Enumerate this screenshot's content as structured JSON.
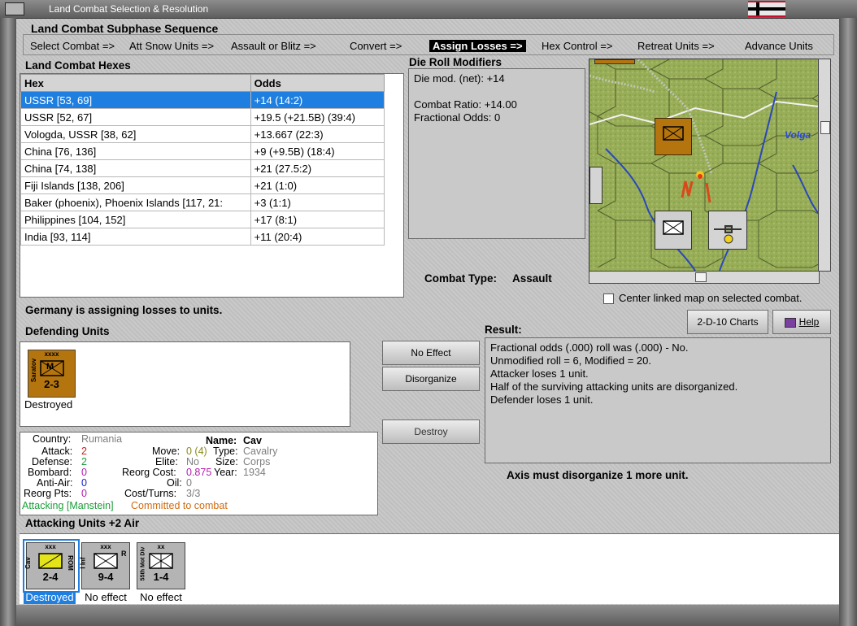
{
  "window": {
    "title": "Land Combat Selection & Resolution"
  },
  "sequence": {
    "label": "Land Combat Subphase Sequence",
    "steps": [
      {
        "label": "Select Combat =>"
      },
      {
        "label": "Att Snow Units =>"
      },
      {
        "label": "Assault or Blitz =>"
      },
      {
        "label": "Convert =>"
      },
      {
        "label": "Assign Losses =>",
        "active": true
      },
      {
        "label": "Hex Control =>"
      },
      {
        "label": "Retreat Units =>"
      },
      {
        "label": "Advance Units"
      }
    ]
  },
  "hexes": {
    "title": "Land Combat Hexes",
    "columns": [
      "Hex",
      "Odds"
    ],
    "rows": [
      {
        "hex": "USSR [53, 69]",
        "odds": "+14 (14:2)"
      },
      {
        "hex": "USSR [52, 67]",
        "odds": "+19.5 (+21.5B) (39:4)"
      },
      {
        "hex": "Vologda, USSR [38, 62]",
        "odds": "+13.667 (22:3)"
      },
      {
        "hex": "China [76, 136]",
        "odds": "+9 (+9.5B) (18:4)"
      },
      {
        "hex": "China [74, 138]",
        "odds": "+21 (27.5:2)"
      },
      {
        "hex": "Fiji Islands [138, 206]",
        "odds": "+21 (1:0)"
      },
      {
        "hex": "Baker (phoenix), Phoenix Islands [117, 21:",
        "odds": "+3 (1:1)"
      },
      {
        "hex": "Philippines [104, 152]",
        "odds": "+17 (8:1)"
      },
      {
        "hex": "India [93, 114]",
        "odds": "+11 (20:4)"
      }
    ]
  },
  "modifiers": {
    "title": "Die Roll Modifiers",
    "die_mod": "Die mod. (net): +14",
    "combat_ratio": "Combat Ratio: +14.00",
    "fractional_odds": "Fractional Odds: 0"
  },
  "combat_type": {
    "label": "Combat Type:",
    "value": "Assault"
  },
  "map": {
    "river_label": "Volga",
    "center_checkbox_label": "Center linked map on selected combat."
  },
  "status_line": "Germany is assigning losses to units.",
  "defending": {
    "title": "Defending Units",
    "units": [
      {
        "top": "xxxx",
        "side": "Saratov",
        "symbol": "M",
        "stats": "2-3",
        "status": "Destroyed"
      }
    ]
  },
  "actions": {
    "no_effect": "No Effect",
    "disorganize": "Disorganize",
    "destroy": "Destroy",
    "charts": "2-D-10 Charts",
    "help": "Help"
  },
  "result": {
    "title": "Result:",
    "lines": [
      "Fractional odds (.000) roll was (.000)  - No.",
      "Unmodified roll = 6, Modified = 20.",
      "Attacker loses 1 unit.",
      "Half of the surviving attacking units are disorganized.",
      "Defender loses 1 unit."
    ],
    "note": "Axis must disorganize 1 more unit."
  },
  "unit_info": {
    "country_label": "Country:",
    "country": "Rumania",
    "name_label": "Name:",
    "name": "Cav",
    "attack_label": "Attack:",
    "attack": "2",
    "move_label": "Move:",
    "move": "0 (4)",
    "type_label": "Type:",
    "type": "Cavalry",
    "defense_label": "Defense:",
    "defense": "2",
    "elite_label": "Elite:",
    "elite": "No",
    "size_label": "Size:",
    "size": "Corps",
    "bombard_label": "Bombard:",
    "bombard": "0",
    "reorg_cost_label": "Reorg Cost:",
    "reorg_cost": "0.875",
    "year_label": "Year:",
    "year": "1934",
    "antiair_label": "Anti-Air:",
    "antiair": "0",
    "oil_label": "Oil:",
    "oil": "0",
    "reorg_pts_label": "Reorg Pts:",
    "reorg_pts": "0",
    "cost_turns_label": "Cost/Turns:",
    "cost_turns": "3/3",
    "attacking": "Attacking [Manstein]",
    "committed": "Committed to combat"
  },
  "attacking": {
    "title": "Attacking Units +2 Air",
    "units": [
      {
        "top": "xxx",
        "side": "Cav",
        "right": "ROM",
        "stats": "2-4",
        "status": "Destroyed",
        "color": "#e4e41a"
      },
      {
        "top": "xxx",
        "side": "I Inf",
        "right": "R",
        "stats": "9-4",
        "status": "No effect",
        "color": "#b4b4b4"
      },
      {
        "top": "xx",
        "side": "55th Mot Div",
        "right": "",
        "stats": "1-4",
        "status": "No effect",
        "color": "#b4b4b4"
      }
    ]
  },
  "colors": {
    "selection": "#1f7fe0",
    "axis_unit": "#b5750e",
    "rumanian_unit": "#e4e41a",
    "german_unit": "#b4b4b4"
  }
}
